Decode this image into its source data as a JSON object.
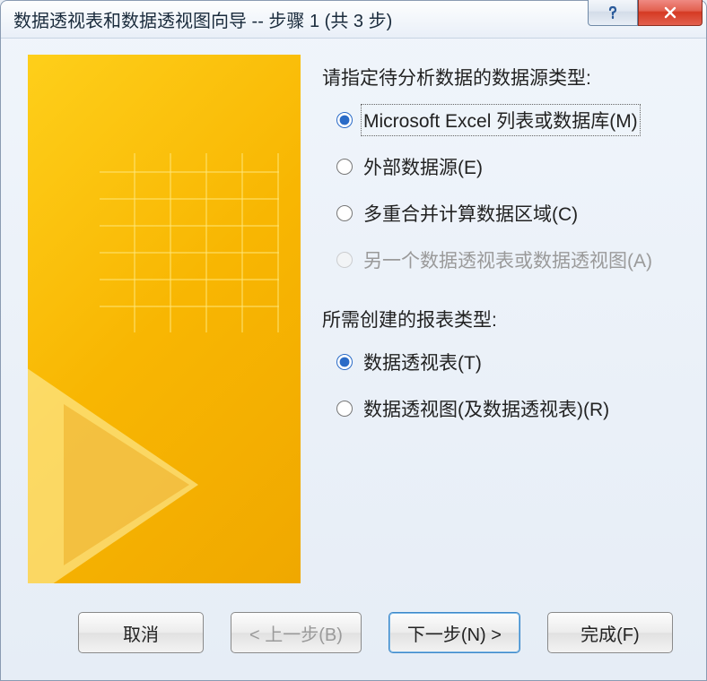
{
  "titlebar": {
    "title": "数据透视表和数据透视图向导 -- 步骤 1 (共 3 步)"
  },
  "section1": {
    "label": "请指定待分析数据的数据源类型:",
    "options": {
      "excelList": "Microsoft Excel 列表或数据库(M)",
      "external": "外部数据源(E)",
      "multi": "多重合并计算数据区域(C)",
      "another": "另一个数据透视表或数据透视图(A)"
    }
  },
  "section2": {
    "label": "所需创建的报表类型:",
    "options": {
      "table": "数据透视表(T)",
      "chart": "数据透视图(及数据透视表)(R)"
    }
  },
  "buttons": {
    "cancel": "取消",
    "back": "< 上一步(B)",
    "next": "下一步(N) >",
    "finish": "完成(F)"
  }
}
